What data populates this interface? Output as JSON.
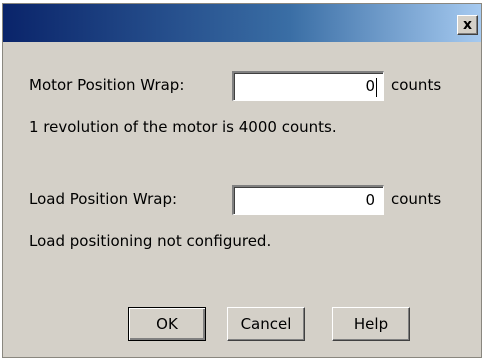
{
  "dialog": {
    "close_glyph": "x"
  },
  "motor": {
    "label": "Motor Position Wrap:",
    "value": "0",
    "unit": "counts",
    "note": "1 revolution of the motor is 4000 counts."
  },
  "load": {
    "label": "Load Position Wrap:",
    "value": "0",
    "unit": "counts",
    "note": "Load positioning not configured."
  },
  "buttons": {
    "ok": "OK",
    "cancel": "Cancel",
    "help": "Help"
  }
}
